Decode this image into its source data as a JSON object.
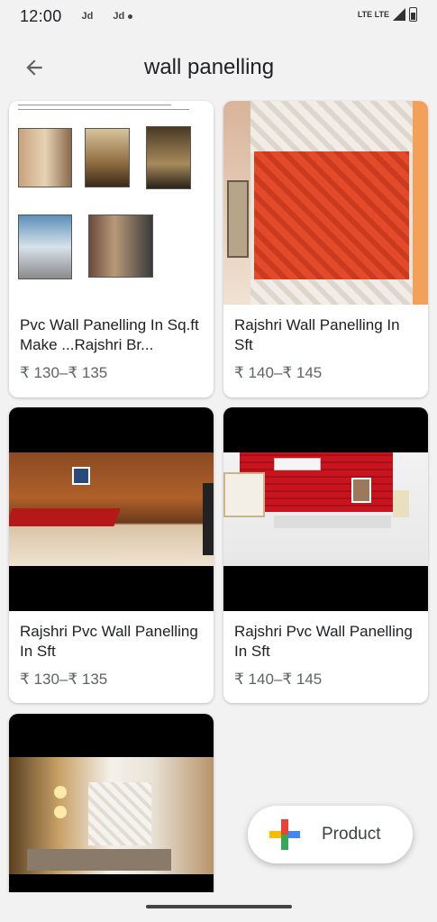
{
  "status_bar": {
    "time": "12:00",
    "app1": "Jd",
    "app2": "Jd",
    "network": "LTE LTE"
  },
  "header": {
    "title": "wall panelling"
  },
  "products": [
    {
      "title": "Pvc Wall Panelling In Sq.ft Make ...Rajshri Br...",
      "price": "₹ 130–₹ 135"
    },
    {
      "title": "Rajshri Wall Panelling In Sft",
      "price": "₹ 140–₹ 145"
    },
    {
      "title": "Rajshri Pvc Wall Panelling In Sft",
      "price": "₹ 130–₹ 135"
    },
    {
      "title": "Rajshri Pvc Wall Panelling In Sft",
      "price": "₹ 140–₹ 145"
    }
  ],
  "fab": {
    "label": "Product"
  },
  "colors": {
    "google_blue": "#4285F4",
    "google_red": "#EA4335",
    "google_yellow": "#FBBC05",
    "google_green": "#34A853"
  }
}
